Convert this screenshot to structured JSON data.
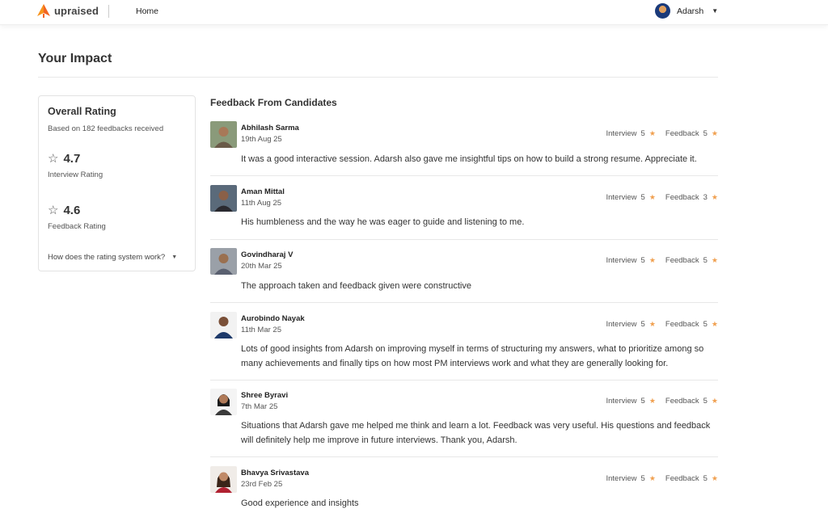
{
  "header": {
    "brand": "upraised",
    "nav_home": "Home",
    "user_name": "Adarsh"
  },
  "page": {
    "title": "Your Impact"
  },
  "rating_card": {
    "title": "Overall Rating",
    "subtitle": "Based on 182 feedbacks received",
    "interview_value": "4.7",
    "interview_label": "Interview Rating",
    "feedback_value": "4.6",
    "feedback_label": "Feedback Rating",
    "how_link": "How does the rating system work?"
  },
  "feedback": {
    "heading": "Feedback From Candidates",
    "interview_label": "Interview",
    "feedback_label": "Feedback",
    "items": [
      {
        "name": "Abhilash Sarma",
        "date": "19th Aug 25",
        "interview": "5",
        "feedback": "5",
        "text": "It was a good interactive session. Adarsh also gave me insightful tips on how to build a strong resume. Appreciate it."
      },
      {
        "name": "Aman Mittal",
        "date": "11th Aug 25",
        "interview": "5",
        "feedback": "3",
        "text": "His humbleness and the way he was eager to guide and listening to me."
      },
      {
        "name": "Govindharaj V",
        "date": "20th Mar 25",
        "interview": "5",
        "feedback": "5",
        "text": "The approach taken and feedback given were constructive"
      },
      {
        "name": "Aurobindo Nayak",
        "date": "11th Mar 25",
        "interview": "5",
        "feedback": "5",
        "text": "Lots of good insights from Adarsh on improving myself in terms of structuring my answers, what to prioritize among so many achievements and finally tips on how most PM interviews work and what they are generally looking for."
      },
      {
        "name": "Shree Byravi",
        "date": "7th Mar 25",
        "interview": "5",
        "feedback": "5",
        "text": "Situations that Adarsh gave me helped me think and learn a lot. Feedback was very useful. His questions and feedback will definitely help me improve in future interviews. Thank you, Adarsh."
      },
      {
        "name": "Bhavya Srivastava",
        "date": "23rd Feb 25",
        "interview": "5",
        "feedback": "5",
        "text": "Good experience and insights"
      }
    ]
  },
  "colors": {
    "accent_orange": "#f26522",
    "star": "#f0a050"
  }
}
